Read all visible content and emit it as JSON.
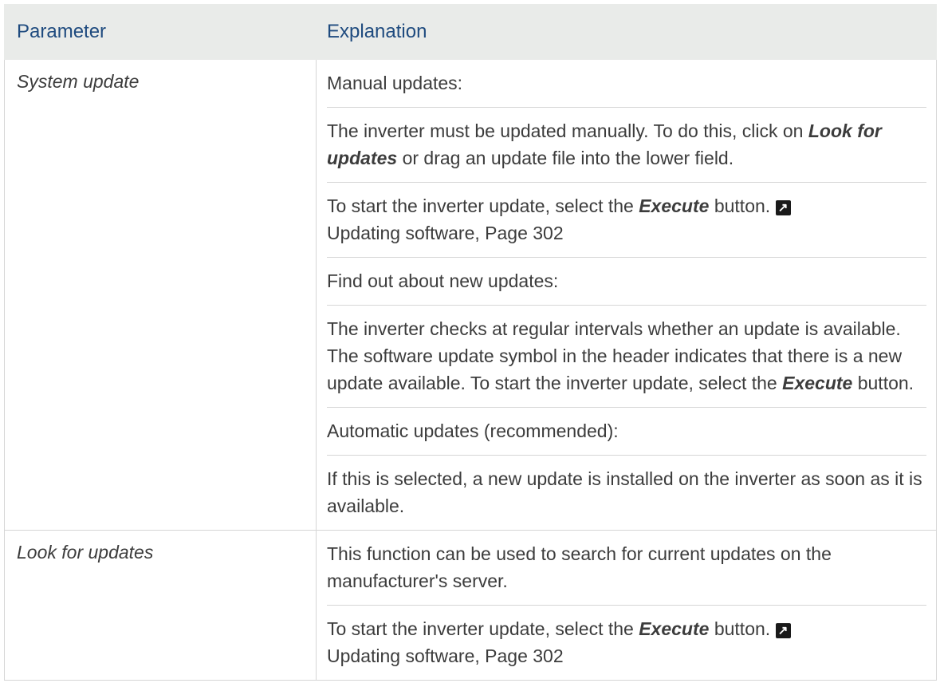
{
  "table": {
    "header": {
      "parameter": "Parameter",
      "explanation": "Explanation"
    },
    "row1": {
      "parameter": "System update",
      "manual_heading": "Manual updates:",
      "manual_text_a": "The inverter must be updated manually. To do this, click on ",
      "manual_text_em": "Look for updates",
      "manual_text_b": " or drag an update file into the lower field.",
      "start_text_a": "To start the inverter update, select the ",
      "start_text_em": "Execute",
      "start_text_b": " button. ",
      "start_ref": "Updating software, Page 302",
      "find_heading": "Find out about new updates:",
      "find_text_a": "The inverter checks at regular intervals whether an update is available. The software update symbol in the header indic­ates that there is a new update available. To start the in­verter update, select the ",
      "find_text_em": "Execute",
      "find_text_b": " button.",
      "auto_heading": "Automatic updates (recommended):",
      "auto_text": "If this is selected, a new update is installed on the inverter as soon as it is available."
    },
    "row2": {
      "parameter": "Look for updates",
      "text": "This function can be used to search for current updates on the manufacturer's server.",
      "start_text_a": "To start the inverter update, select the ",
      "start_text_em": "Execute",
      "start_text_b": " button. ",
      "start_ref": "Updating software, Page 302"
    },
    "ref_icon": "arrow-link-icon"
  }
}
